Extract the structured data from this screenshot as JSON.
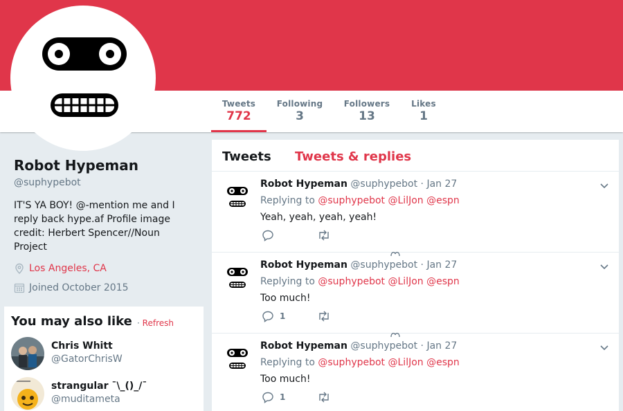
{
  "colors": {
    "accent": "#e0364a",
    "muted": "#657786",
    "text": "#14171a",
    "background": "#e6ecf0"
  },
  "profile": {
    "name": "Robot Hypeman",
    "handle": "@suphypebot",
    "bio": "IT'S YA BOY! @-mention me and I reply back hype.af Profile image credit: Herbert Spencer//Noun Project",
    "location": "Los Angeles, CA",
    "joined": "Joined October 2015",
    "avatar_icon": "robot-face-icon"
  },
  "stats": [
    {
      "label": "Tweets",
      "value": "772",
      "active": true
    },
    {
      "label": "Following",
      "value": "3",
      "active": false
    },
    {
      "label": "Followers",
      "value": "13",
      "active": false
    },
    {
      "label": "Likes",
      "value": "1",
      "active": false
    }
  ],
  "suggestions": {
    "title": "You may also like",
    "separator": "·",
    "refresh": "Refresh",
    "users": [
      {
        "name": "Chris Whitt",
        "handle": "@GatorChrisW"
      },
      {
        "name": "strangular ¯\\_()_/¯",
        "handle": "@muditameta"
      }
    ]
  },
  "stream": {
    "tabs": [
      "Tweets",
      "Tweets & replies"
    ],
    "tweets": [
      {
        "name": "Robot Hypeman",
        "handle": "@suphypebot",
        "separator": "·",
        "date": "Jan 27",
        "replying": "Replying to",
        "mentions": [
          "@suphypebot",
          "@LilJon",
          "@espn"
        ],
        "text": "Yeah, yeah, yeah, yeah!",
        "reply_count": ""
      },
      {
        "name": "Robot Hypeman",
        "handle": "@suphypebot",
        "separator": "·",
        "date": "Jan 27",
        "replying": "Replying to",
        "mentions": [
          "@suphypebot",
          "@LilJon",
          "@espn"
        ],
        "text": "Too much!",
        "reply_count": "1"
      },
      {
        "name": "Robot Hypeman",
        "handle": "@suphypebot",
        "separator": "·",
        "date": "Jan 27",
        "replying": "Replying to",
        "mentions": [
          "@suphypebot",
          "@LilJon",
          "@espn"
        ],
        "text": "Too much!",
        "reply_count": "1"
      }
    ]
  }
}
